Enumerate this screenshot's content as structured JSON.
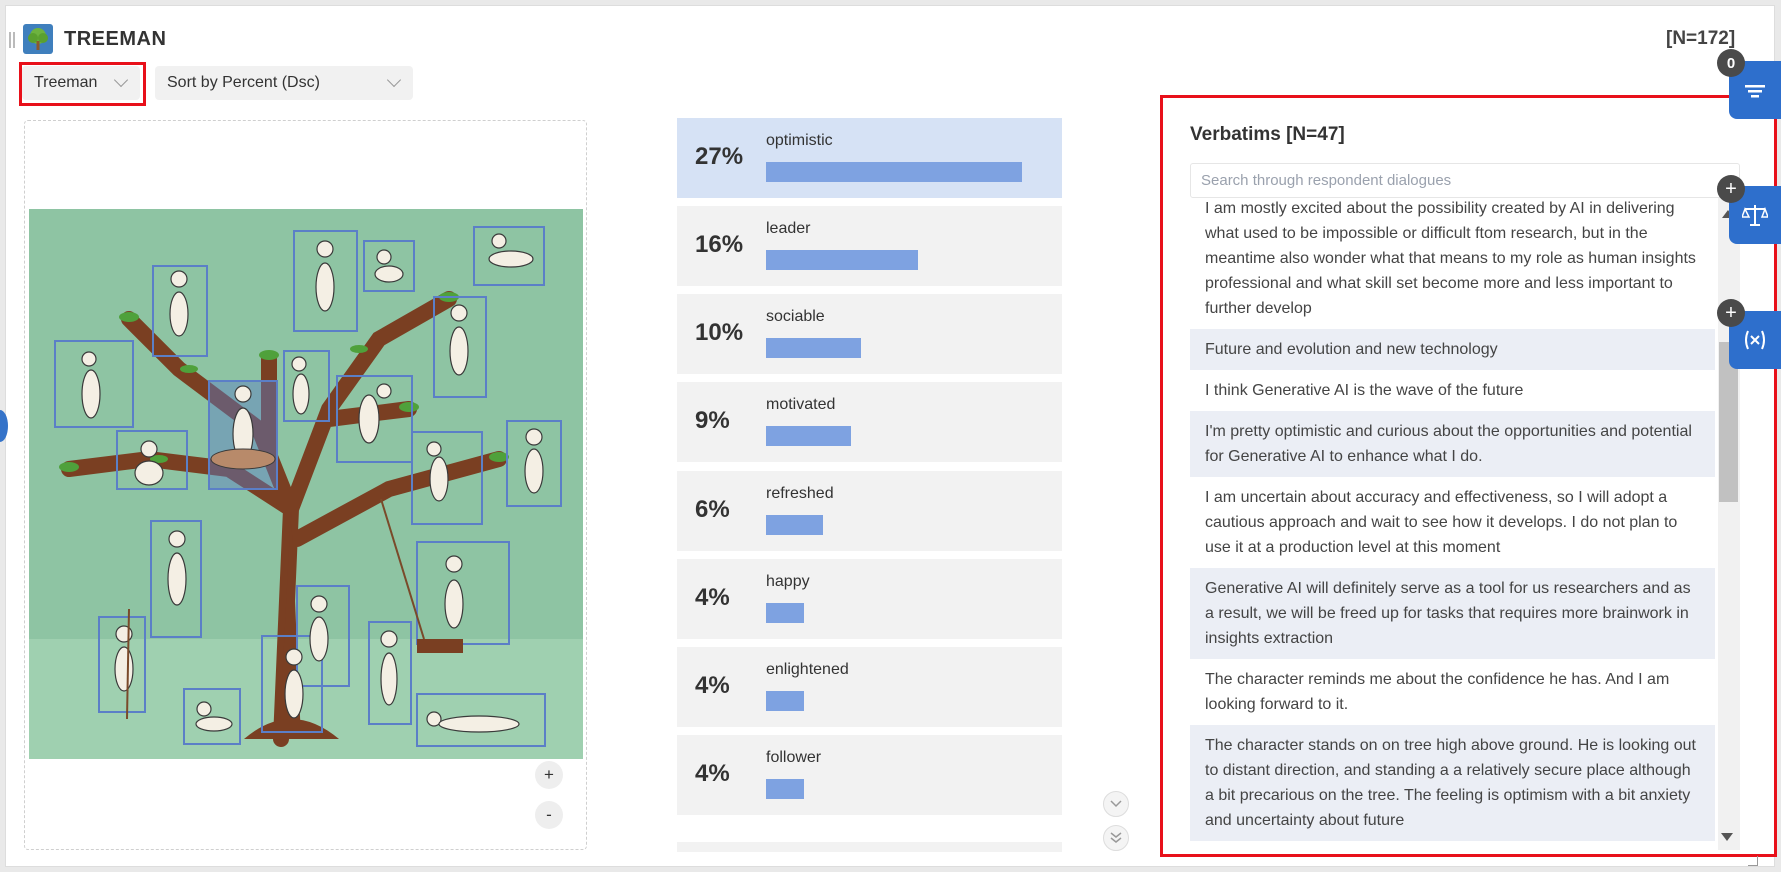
{
  "header": {
    "title": "TREEMAN",
    "total_n": "[N=172]"
  },
  "filters": {
    "image_select": "Treeman",
    "sort_select": "Sort by Percent (Dsc)"
  },
  "zoom": {
    "in_label": "+",
    "out_label": "-"
  },
  "bars": [
    {
      "pct": "27%",
      "label": "optimistic",
      "value": 27
    },
    {
      "pct": "16%",
      "label": "leader",
      "value": 16
    },
    {
      "pct": "10%",
      "label": "sociable",
      "value": 10
    },
    {
      "pct": "9%",
      "label": "motivated",
      "value": 9
    },
    {
      "pct": "6%",
      "label": "refreshed",
      "value": 6
    },
    {
      "pct": "4%",
      "label": "happy",
      "value": 4
    },
    {
      "pct": "4%",
      "label": "enlightened",
      "value": 4
    },
    {
      "pct": "4%",
      "label": "follower",
      "value": 4
    }
  ],
  "verbatims": {
    "title": "Verbatims [N=47]",
    "search_placeholder": "Search through respondent dialogues",
    "items": [
      "I am mostly excited about the possibility created by AI in delivering what used to be impossible or difficult ftom research, but in the meantime also wonder what that means to my role as human insights professional and what skill set become more and less important to further develop",
      "Future and evolution and new technology",
      "I think Generative AI is the wave of the future",
      "I'm pretty optimistic and curious about the opportunities and potential for Generative AI to enhance what I do.",
      "I am uncertain about accuracy and effectiveness, so I will adopt a cautious approach and wait to see how it develops. I do not plan to use it at a production level at this moment",
      "Generative AI will definitely serve as a tool for us researchers and as a result, we will be freed up for tasks that requires more brainwork in insights extraction",
      "The character reminds me about the confidence he has. And I am looking forward to it.",
      "The character stands on on tree high above ground. He is looking out to distant direction, and standing a a relatively secure place although a bit precarious on the tree. The feeling is optimism with a bit anxiety and uncertainty about future"
    ]
  },
  "side_panel": {
    "filter_count": "0",
    "add_label": "+"
  },
  "colors": {
    "accent_blue": "#2e6fcc",
    "bar_fill": "#7ea2e1",
    "highlight_row": "#d6e2f5",
    "annotation_red": "#e8101a",
    "tree_bg": "#8ec4a3"
  }
}
